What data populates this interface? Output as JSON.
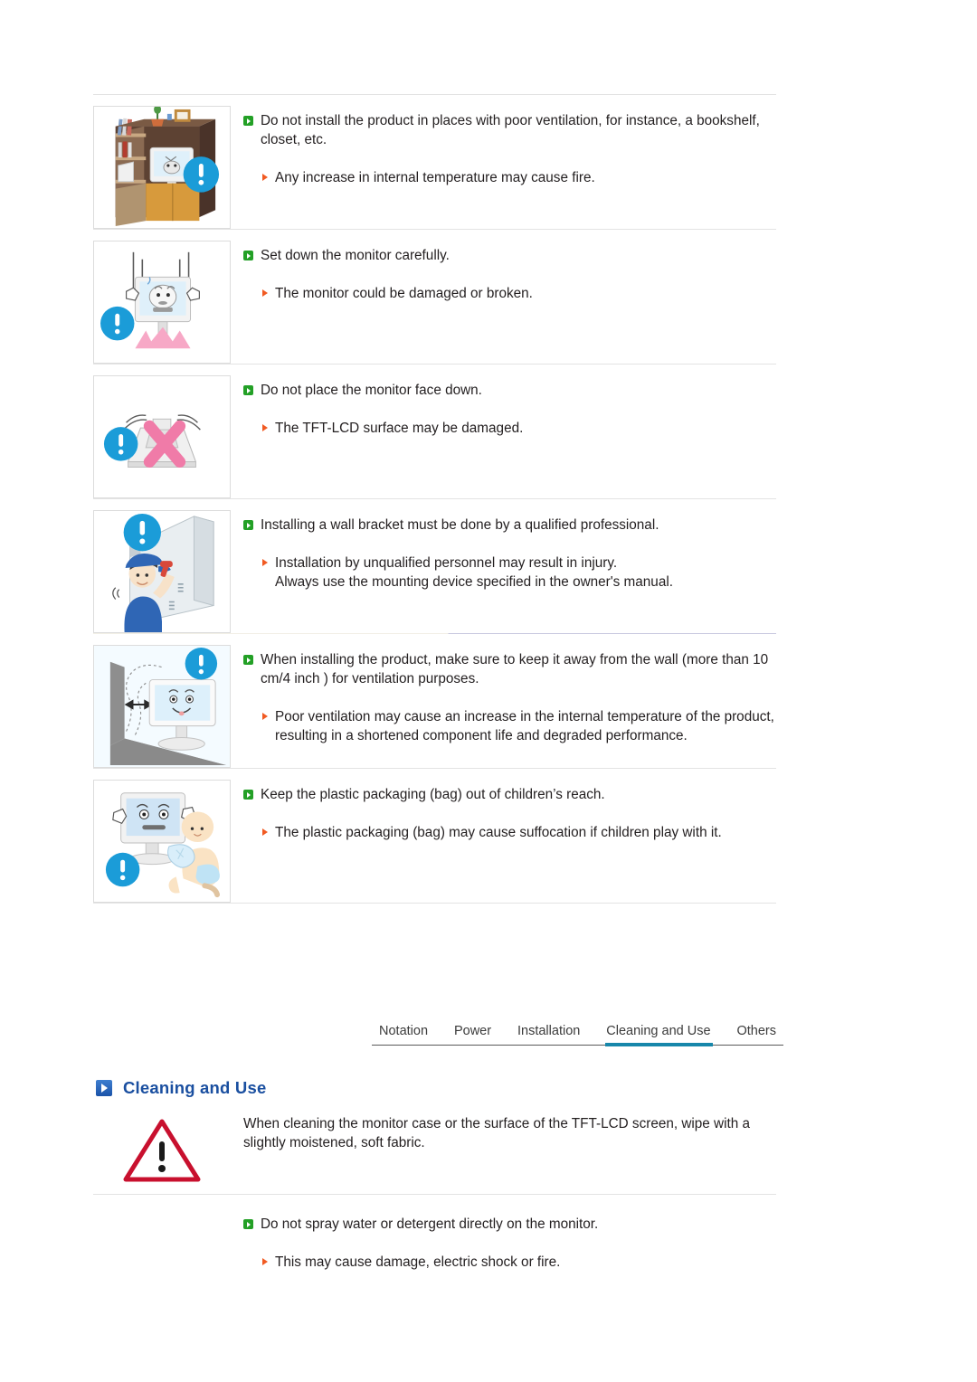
{
  "document": {
    "type": "monitor-user-manual-safety-instructions"
  },
  "sections": [
    {
      "id": "ventilation",
      "image_name": "bookshelf-monitor-caution-illustration",
      "main": "Do not install the product in places with poor ventilation, for instance, a bookshelf, closet, etc.",
      "sub": [
        "Any increase in internal temperature may cause fire."
      ]
    },
    {
      "id": "set-down",
      "image_name": "monitor-set-down-caution-illustration",
      "main": "Set down the monitor carefully.",
      "sub": [
        "The monitor could be damaged or broken."
      ]
    },
    {
      "id": "face-down",
      "image_name": "monitor-face-down-x-caution-illustration",
      "main": "Do not place the monitor face down.",
      "sub": [
        "The TFT-LCD surface may be damaged."
      ]
    },
    {
      "id": "wall-bracket",
      "image_name": "wall-bracket-installer-caution-illustration",
      "main": "Installing a wall bracket must be done by a qualified professional.",
      "sub": [
        "Installation by unqualified personnel may result in injury.\nAlways use the mounting device specified in the owner's manual."
      ]
    },
    {
      "id": "wall-distance",
      "image_name": "monitor-wall-distance-caution-illustration",
      "main": "When installing the product, make sure to keep it away from the wall (more than 10 cm/4 inch ) for ventilation purposes.",
      "sub": [
        "Poor ventilation may cause an increase in the internal temperature of the product, resulting in a shortened component life and degraded performance."
      ]
    },
    {
      "id": "plastic-bag",
      "image_name": "baby-plastic-bag-caution-illustration",
      "main": "Keep the plastic packaging (bag) out of children’s reach.",
      "sub": [
        "The plastic packaging (bag) may cause suffocation if children play with it."
      ]
    }
  ],
  "tabs": {
    "items": [
      {
        "label": "Notation",
        "active": false
      },
      {
        "label": "Power",
        "active": false
      },
      {
        "label": "Installation",
        "active": false
      },
      {
        "label": "Cleaning and Use",
        "active": true
      },
      {
        "label": "Others",
        "active": false
      }
    ],
    "active_index": 3
  },
  "section_heading": {
    "label": "Cleaning and Use",
    "icon": "blue-play-square-icon"
  },
  "cleaning": {
    "warning_icon": "warning-triangle-icon",
    "note": "When cleaning the monitor case or the surface of the TFT-LCD screen, wipe with a slightly moistened, soft fabric.",
    "main": "Do not spray water or detergent directly on the monitor.",
    "sub": "This may cause damage, electric shock or fire."
  },
  "colors": {
    "bullet_green": "#23a026",
    "bullet_orange": "#f15a22",
    "heading_blue": "#1a4fa0",
    "tab_active_underline": "#1787aa",
    "warning_red": "#c8102e",
    "caution_badge_blue": "#1b9cd8"
  }
}
